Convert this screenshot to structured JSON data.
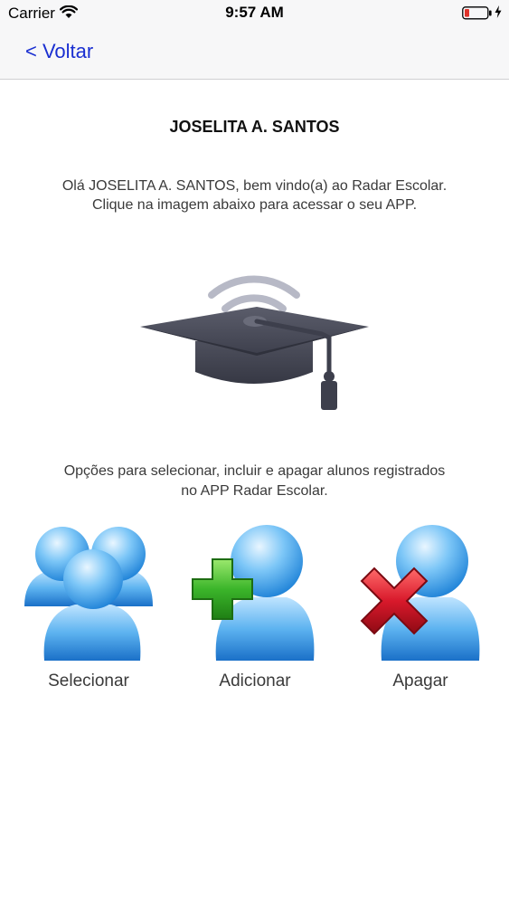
{
  "status_bar": {
    "carrier": "Carrier",
    "time": "9:57 AM",
    "icons": [
      "wifi-icon",
      "battery-icon",
      "charging-icon"
    ],
    "battery_color": "#e0332b"
  },
  "nav": {
    "back_label": "< Voltar",
    "accent_color": "#1a2fd1"
  },
  "content": {
    "user_name": "JOSELITA A. SANTOS",
    "welcome_line1": "Olá JOSELITA A. SANTOS, bem vindo(a) ao Radar Escolar.",
    "welcome_line2": "Clique na imagem abaixo para acessar o seu APP.",
    "app_image_icon": "graduation-cap-wifi-icon",
    "options_line1": "Opções para selecionar, incluir e apagar alunos registrados",
    "options_line2": "no APP Radar Escolar."
  },
  "actions": {
    "select": {
      "label": "Selecionar",
      "icon": "users-group-icon"
    },
    "add": {
      "label": "Adicionar",
      "icon": "user-add-icon",
      "badge_color": "#3bb52a"
    },
    "delete": {
      "label": "Apagar",
      "icon": "user-delete-icon",
      "badge_color": "#d8192b"
    }
  }
}
